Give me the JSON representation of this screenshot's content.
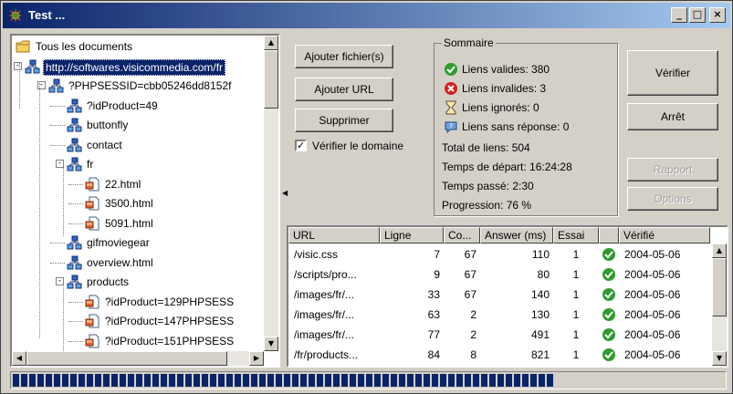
{
  "window": {
    "title": "Test ...",
    "controls": {
      "minimize": "_",
      "maximize": "□",
      "close": "×"
    }
  },
  "tree": {
    "items": [
      {
        "label": "Tous les documents",
        "icon": "folder-icon",
        "level": 0,
        "expander": ""
      },
      {
        "label": "http://softwares.visicommedia.com/fr",
        "icon": "sitemap-icon",
        "level": 0,
        "expander": "-",
        "selected": true
      },
      {
        "label": "?PHPSESSID=cbb05246dd8152f",
        "icon": "sitemap-icon",
        "level": 1,
        "expander": "-"
      },
      {
        "label": "?idProduct=49",
        "icon": "sitemap-icon",
        "level": 2,
        "expander": ""
      },
      {
        "label": "buttonfly",
        "icon": "sitemap-icon",
        "level": 2,
        "expander": ""
      },
      {
        "label": "contact",
        "icon": "sitemap-icon",
        "level": 2,
        "expander": ""
      },
      {
        "label": "fr",
        "icon": "sitemap-icon",
        "level": 2,
        "expander": "-"
      },
      {
        "label": "22.html",
        "icon": "page-icon",
        "level": 3,
        "expander": ""
      },
      {
        "label": "3500.html",
        "icon": "page-icon",
        "level": 3,
        "expander": ""
      },
      {
        "label": "5091.html",
        "icon": "page-icon",
        "level": 3,
        "expander": ""
      },
      {
        "label": "gifmoviegear",
        "icon": "sitemap-icon",
        "level": 2,
        "expander": ""
      },
      {
        "label": "overview.html",
        "icon": "sitemap-icon",
        "level": 2,
        "expander": ""
      },
      {
        "label": "products",
        "icon": "sitemap-icon",
        "level": 2,
        "expander": "-"
      },
      {
        "label": "?idProduct=129PHPSESS",
        "icon": "page-icon",
        "level": 3,
        "expander": ""
      },
      {
        "label": "?idProduct=147PHPSESS",
        "icon": "page-icon",
        "level": 3,
        "expander": ""
      },
      {
        "label": "?idProduct=151PHPSESS",
        "icon": "page-icon",
        "level": 3,
        "expander": ""
      }
    ]
  },
  "buttons": {
    "add_files": "Ajouter fichier(s)",
    "add_url": "Ajouter URL",
    "delete": "Supprimer",
    "verify": "Vérifier",
    "stop": "Arrêt",
    "report": "Rapport",
    "options": "Options"
  },
  "verify_domain": {
    "label": "Vérifier le domaine",
    "checked": "✓"
  },
  "summary": {
    "legend": "Sommaire",
    "valid": "Liens valides: 380",
    "invalid": "Liens invalides: 3",
    "ignored": "Liens ignorés: 0",
    "no_response": "Liens sans réponse: 0",
    "total": "Total de liens: 504",
    "start_time": "Temps de départ: 16:24:28",
    "elapsed": "Temps passé: 2:30",
    "progress": "Progression: 76 %"
  },
  "table": {
    "columns": [
      "URL",
      "Ligne",
      "Co...",
      "Answer (ms)",
      "Essai",
      "",
      "Vérifié"
    ],
    "rows": [
      [
        "/visic.css",
        "7",
        "67",
        "110",
        "1",
        "ok",
        "2004-05-06"
      ],
      [
        "/scripts/pro...",
        "9",
        "67",
        "80",
        "1",
        "ok",
        "2004-05-06"
      ],
      [
        "/images/fr/...",
        "33",
        "67",
        "140",
        "1",
        "ok",
        "2004-05-06"
      ],
      [
        "/images/fr/...",
        "63",
        "2",
        "130",
        "1",
        "ok",
        "2004-05-06"
      ],
      [
        "/images/fr/...",
        "77",
        "2",
        "491",
        "1",
        "ok",
        "2004-05-06"
      ],
      [
        "/fr/products...",
        "84",
        "8",
        "821",
        "1",
        "ok",
        "2004-05-06"
      ]
    ]
  },
  "progress": {
    "fraction": 0.76
  },
  "colors": {
    "selection": "#0a246a",
    "ok": "#2e9c2e",
    "error": "#d42020"
  }
}
